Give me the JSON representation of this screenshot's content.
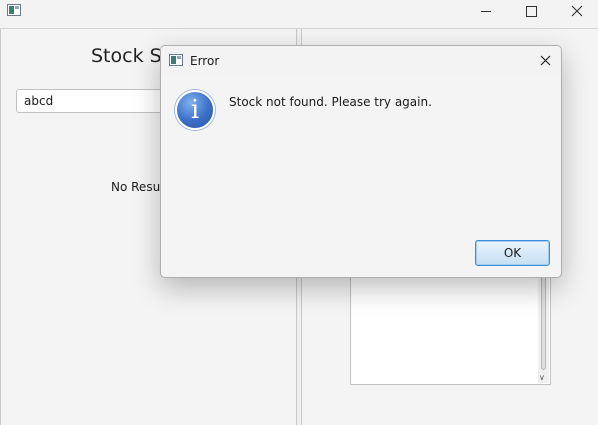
{
  "window": {
    "title": "",
    "icon": "java-app-icon",
    "controls": [
      "minimize-icon",
      "maximize-icon",
      "close-icon"
    ]
  },
  "left_panel": {
    "title": "Stock Se",
    "search_value": "abcd",
    "results_label": "No Result"
  },
  "right_panel": {
    "result_area_text": ""
  },
  "dialog": {
    "title": "Error",
    "icon": "info-icon",
    "icon_glyph": "i",
    "message": "Stock not found. Please try again.",
    "ok_label": "OK",
    "accent_color": "#3a8ed8"
  }
}
